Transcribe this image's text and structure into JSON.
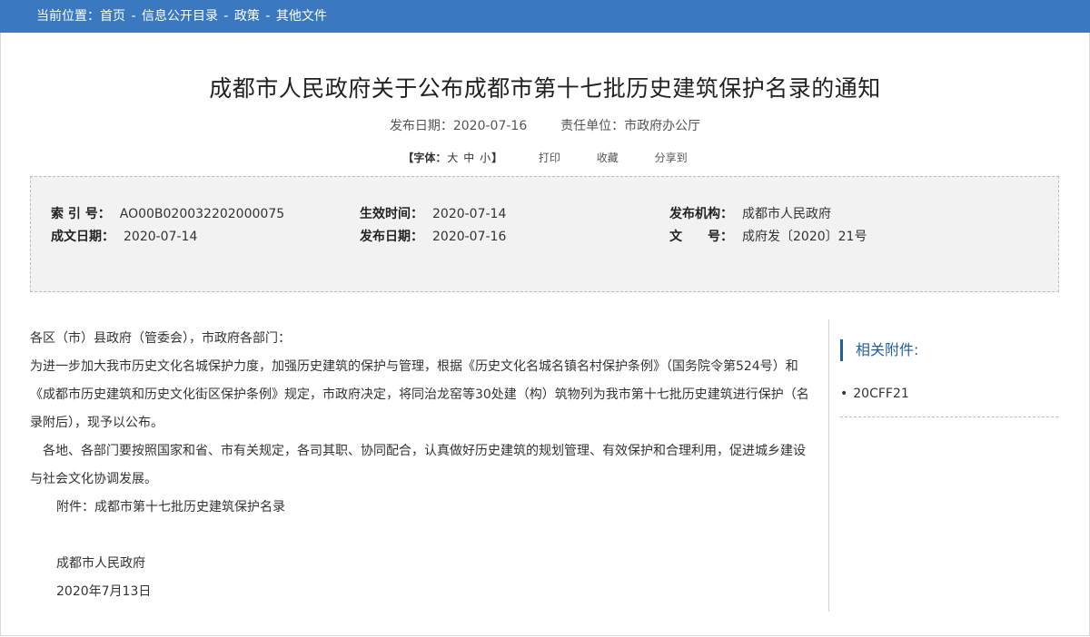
{
  "breadcrumb": {
    "prefix": "当前位置：",
    "items": [
      "首页",
      "信息公开目录",
      "政策",
      "其他文件"
    ],
    "separator": " - "
  },
  "article": {
    "title": "成都市人民政府关于公布成都市第十七批历史建筑保护名录的通知",
    "publish_date_label": "发布日期：",
    "publish_date": "2020-07-16",
    "unit_label": "责任单位：",
    "unit": "市政府办公厅"
  },
  "tools": {
    "font_label": "【字体：",
    "size_large": "大",
    "size_medium": "中",
    "size_small": "小",
    "font_close": "】",
    "print": "打印",
    "favorite": "收藏",
    "share": "分享到"
  },
  "info": {
    "index_label": "索 引 号：",
    "index_value": "AO00B020032202000075",
    "effective_label": "生效时间：",
    "effective_value": "2020-07-14",
    "issuer_label": "发布机构：",
    "issuer_value": "成都市人民政府",
    "written_label": "成文日期：",
    "written_value": "2020-07-14",
    "publish_label": "发布日期：",
    "publish_value": "2020-07-16",
    "docno_label": "文　　号：",
    "docno_value": "成府发〔2020〕21号"
  },
  "content": {
    "salutation": "各区（市）县政府（管委会），市政府各部门：",
    "para1": "为进一步加大我市历史文化名城保护力度，加强历史建筑的保护与管理，根据《历史文化名城名镇名村保护条例》（国务院令第524号）和《成都市历史建筑和历史文化街区保护条例》规定，市政府决定，将同治龙窑等30处建（构）筑物列为我市第十七批历史建筑进行保护（名录附后），现予以公布。",
    "para2": "各地、各部门要按照国家和省、市有关规定，各司其职、协同配合，认真做好历史建筑的规划管理、有效保护和合理利用，促进城乡建设与社会文化协调发展。",
    "attachment_line": "附件：成都市第十七批历史建筑保护名录",
    "signature": "成都市人民政府",
    "sign_date": "2020年7月13日"
  },
  "sidebar": {
    "title": "相关附件:",
    "items": [
      {
        "label": "20CFF21"
      }
    ]
  },
  "colors": {
    "header_bg": "#3a78bf",
    "accent": "#1f5fa8",
    "info_bg": "#f2f2f2"
  }
}
